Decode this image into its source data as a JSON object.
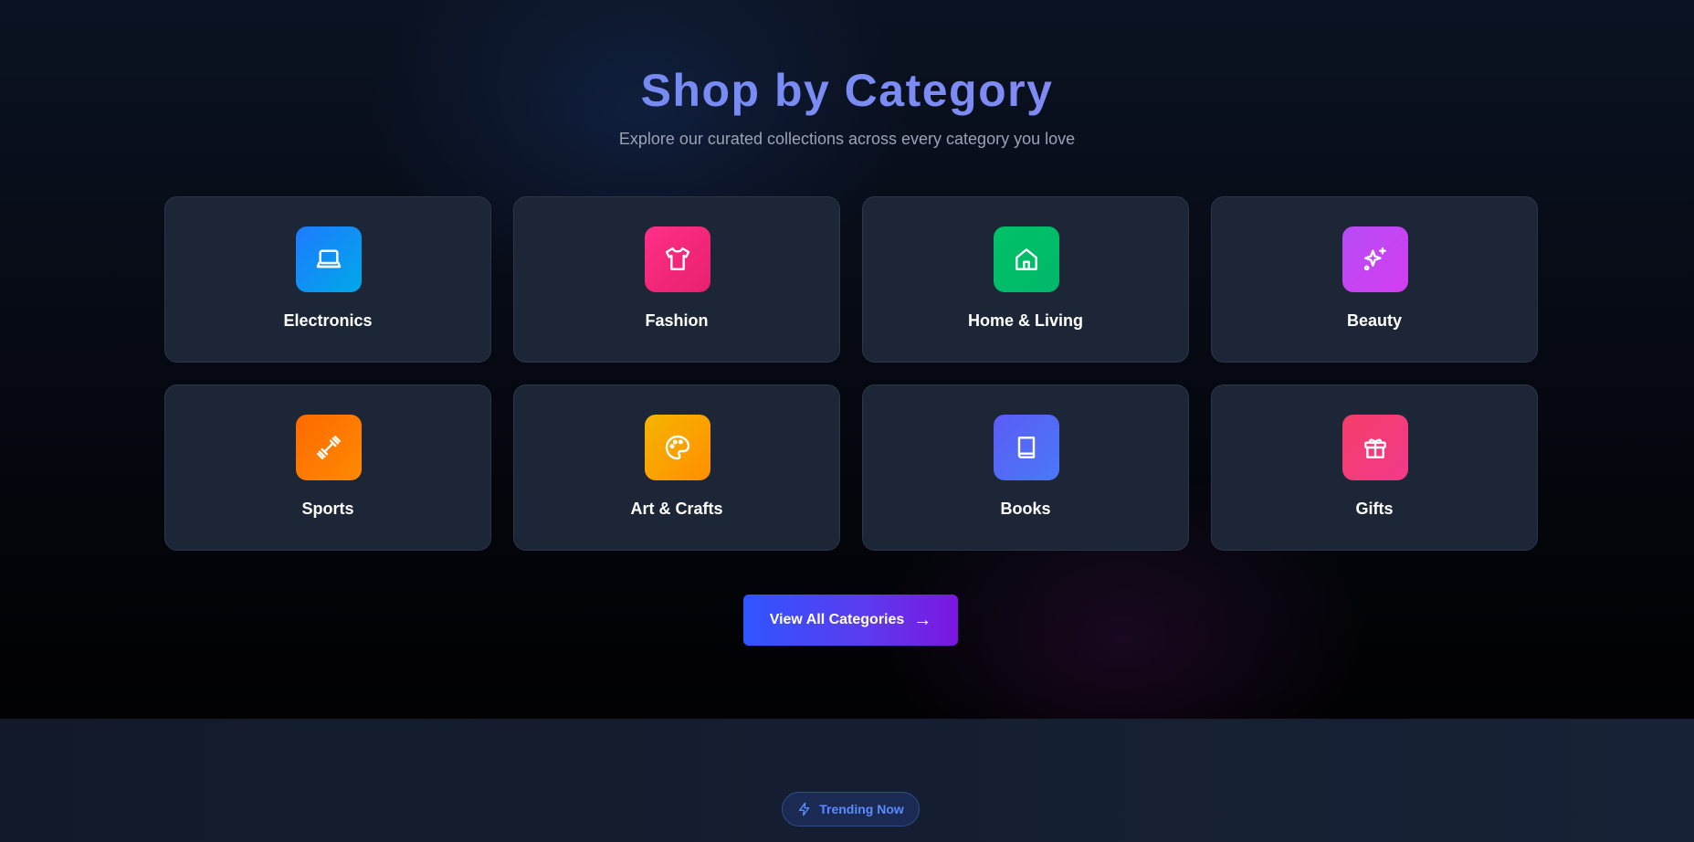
{
  "header": {
    "title": "Shop by Category",
    "subtitle": "Explore our curated collections across every category you love"
  },
  "categories": [
    {
      "label": "Electronics",
      "icon": "laptop-icon",
      "gradient": [
        "#1e7bff",
        "#00a8e8"
      ]
    },
    {
      "label": "Fashion",
      "icon": "shirt-icon",
      "gradient": [
        "#ff2f87",
        "#e8206e"
      ]
    },
    {
      "label": "Home & Living",
      "icon": "home-icon",
      "gradient": [
        "#00c167",
        "#00b86b"
      ]
    },
    {
      "label": "Beauty",
      "icon": "sparkles-icon",
      "gradient": [
        "#b84cf5",
        "#d13df0"
      ]
    },
    {
      "label": "Sports",
      "icon": "dumbbell-icon",
      "gradient": [
        "#ff6a00",
        "#ff8a00"
      ]
    },
    {
      "label": "Art & Crafts",
      "icon": "palette-icon",
      "gradient": [
        "#f5b400",
        "#ff8f00"
      ]
    },
    {
      "label": "Books",
      "icon": "book-icon",
      "gradient": [
        "#5b5cf6",
        "#4a79f7"
      ]
    },
    {
      "label": "Gifts",
      "icon": "gift-icon",
      "gradient": [
        "#f53d6a",
        "#f23a8a"
      ]
    }
  ],
  "cta": {
    "label": "View All Categories",
    "arrow": "→"
  },
  "trending": {
    "badge_label": "Trending Now",
    "icon": "lightning-icon",
    "color": "#5b8cff"
  }
}
